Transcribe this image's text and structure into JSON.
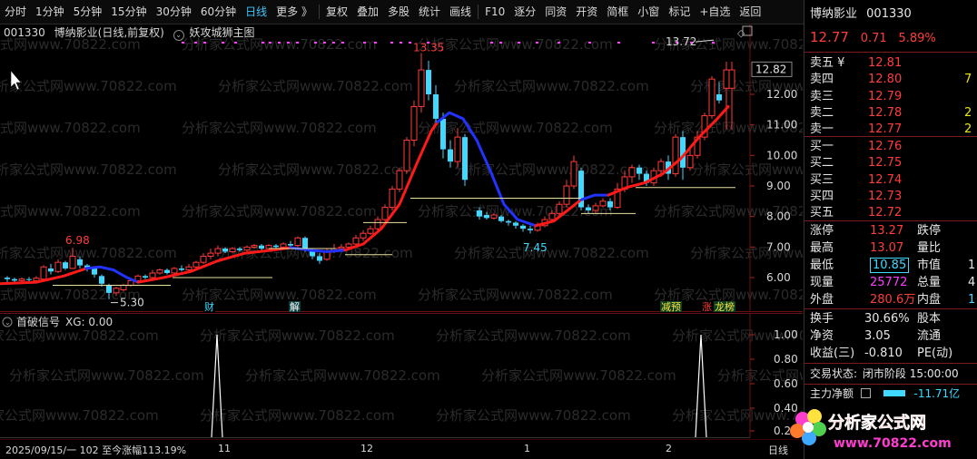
{
  "toolbar": {
    "items": [
      "分时",
      "1分钟",
      "5分钟",
      "15分钟",
      "30分钟",
      "60分钟",
      "日线",
      "更多 》",
      "复权",
      "叠加",
      "多股",
      "统计",
      "画线",
      "F10",
      "逐分",
      "同资",
      "开资",
      "简框",
      "小窗",
      "标记",
      "+自选",
      "返回"
    ],
    "active_index": 6
  },
  "header": {
    "code": "001330",
    "title": "博纳影业(日线,前复权)",
    "indicator": "妖攻城狮主图"
  },
  "main_chart": {
    "price_labels": [
      "12.00",
      "11.00",
      "10.00",
      "9.00",
      "8.00",
      "7.00",
      "6.00"
    ],
    "current_price_tag": "12.82",
    "annotations": {
      "high_13_35": "13.35",
      "high_13_72": "13.72",
      "low_5_30": "5.30",
      "high_6_98": "6.98",
      "low_7_45": "7.45"
    },
    "event_tags": {
      "cai": "财",
      "jie": "解",
      "jianchi": "减预",
      "zhang": "涨",
      "longhubang": "龙榜"
    }
  },
  "sub_chart": {
    "title": "首破信号",
    "value_text": "XG: 0.00",
    "y_labels": [
      "1.00",
      "0.80",
      "0.60",
      "0.40",
      "0.20"
    ]
  },
  "time_axis": {
    "info": "2025/09/15/一  102  至今涨幅113.19%",
    "months": [
      "11",
      "12",
      "1",
      "2"
    ],
    "period_button": "日线"
  },
  "quote": {
    "name": "博纳影业",
    "code": "001330",
    "price": "12.77",
    "change": "0.71",
    "pct": "5.89%",
    "asks": [
      {
        "label": "卖五 ¥",
        "price": "12.81",
        "vol": ""
      },
      {
        "label": "卖四",
        "price": "12.80",
        "vol": "7"
      },
      {
        "label": "卖三",
        "price": "12.79",
        "vol": ""
      },
      {
        "label": "卖二",
        "price": "12.78",
        "vol": "2"
      },
      {
        "label": "卖一",
        "price": "12.77",
        "vol": "2"
      }
    ],
    "bids": [
      {
        "label": "买一",
        "price": "12.76"
      },
      {
        "label": "买二",
        "price": "12.75"
      },
      {
        "label": "买三",
        "price": "12.74"
      },
      {
        "label": "买四",
        "price": "12.73"
      },
      {
        "label": "买五",
        "price": "12.72"
      }
    ],
    "stats": {
      "zhangting_label": "涨停",
      "zhangting": "13.27",
      "dieting_label": "跌停",
      "zuigao_label": "最高",
      "zuigao": "13.07",
      "liangbi_label": "量比",
      "zuidi_label": "最低",
      "zuidi": "10.85",
      "shizhi_label": "市值",
      "shizhi": "1",
      "xianliang_label": "现量",
      "xianliang": "25772",
      "zongliang_label": "总量",
      "zongliang": "4",
      "waipan_label": "外盘",
      "waipan": "280.6万",
      "neipan_label": "内盘",
      "neipan": "1"
    },
    "finance": {
      "huanshou_label": "换手",
      "huanshou": "30.66%",
      "guben_label": "股本",
      "jingzi_label": "净资",
      "jingzi": "3.05",
      "liutong_label": "流通",
      "shouyi_label": "收益(三)",
      "shouyi": "-0.810",
      "pe_label": "PE(动)"
    },
    "status_label": "交易状态:",
    "status_value": "闭市阶段 15:00:00",
    "zhuli_label": "主力净额",
    "zhuli_value": "-11.71亿"
  },
  "watermark": {
    "brand": "分析家公式网",
    "url": "www.70822.com"
  }
}
